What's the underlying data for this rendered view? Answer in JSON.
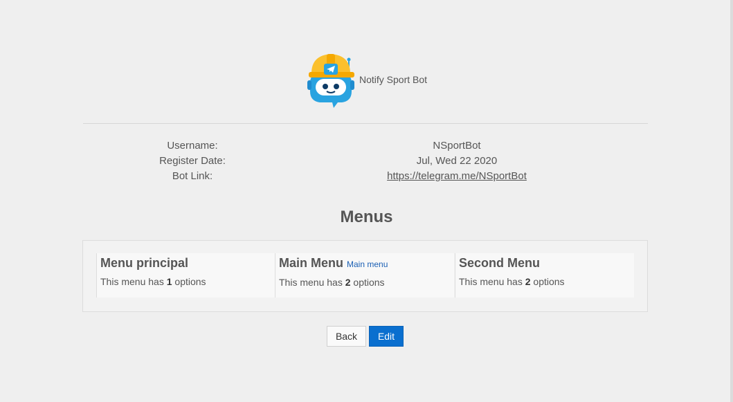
{
  "bot": {
    "name": "Notify Sport Bot"
  },
  "info": {
    "username_label": "Username:",
    "username_value": "NSportBot",
    "register_label": "Register Date:",
    "register_value": "Jul, Wed 22 2020",
    "link_label": "Bot Link:",
    "link_value": "https://telegram.me/NSportBot"
  },
  "menus": {
    "title": "Menus",
    "items": [
      {
        "name": "Menu principal",
        "subtitle": "",
        "desc_prefix": "This menu has ",
        "count": "1",
        "desc_suffix": " options"
      },
      {
        "name": "Main Menu",
        "subtitle": "Main menu",
        "desc_prefix": "This menu has ",
        "count": "2",
        "desc_suffix": " options"
      },
      {
        "name": "Second Menu",
        "subtitle": "",
        "desc_prefix": "This menu has ",
        "count": "2",
        "desc_suffix": " options"
      }
    ]
  },
  "actions": {
    "back_label": "Back",
    "edit_label": "Edit"
  },
  "colors": {
    "background": "#efefef",
    "primary": "#0a6fcf",
    "helmet": "#fbc02d",
    "robot": "#29a3e0"
  },
  "icons": {
    "logo": "robot-helmet-telegram-icon"
  }
}
